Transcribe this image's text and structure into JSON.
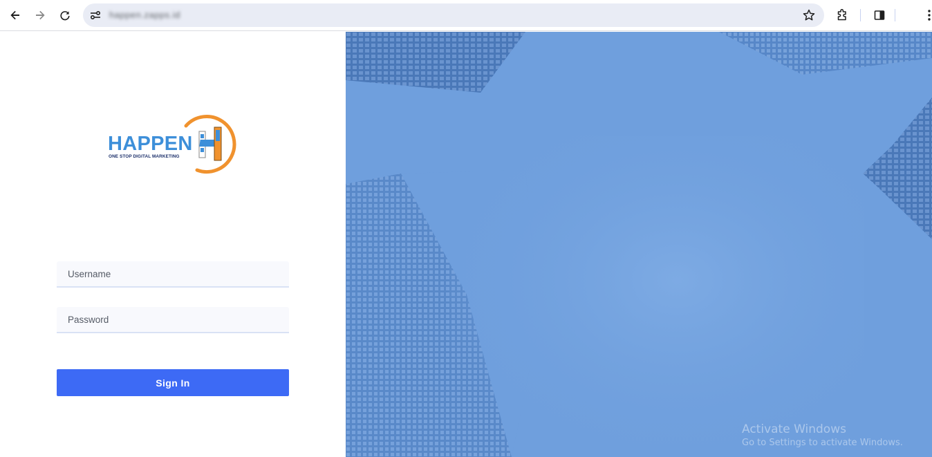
{
  "browser": {
    "url": "happen.zapps.id",
    "icons": [
      "back-arrow-icon",
      "forward-arrow-icon",
      "reload-icon",
      "site-settings-icon",
      "bookmark-star-icon",
      "extensions-icon",
      "side-panel-icon",
      "more-vert-icon"
    ]
  },
  "login": {
    "logo": {
      "wordmark": "HAPPEN",
      "tagline": "ONE STOP DIGITAL MARKETING"
    },
    "username_placeholder": "Username",
    "password_placeholder": "Password",
    "signin_label": "Sign In"
  },
  "colors": {
    "accent": "#3d6af5",
    "logo_blue": "#3d8fd9",
    "logo_orange": "#f0922e",
    "panel_blue": "#6f9fdd"
  },
  "watermark": {
    "title": "Activate Windows",
    "subtitle": "Go to Settings to activate Windows."
  }
}
